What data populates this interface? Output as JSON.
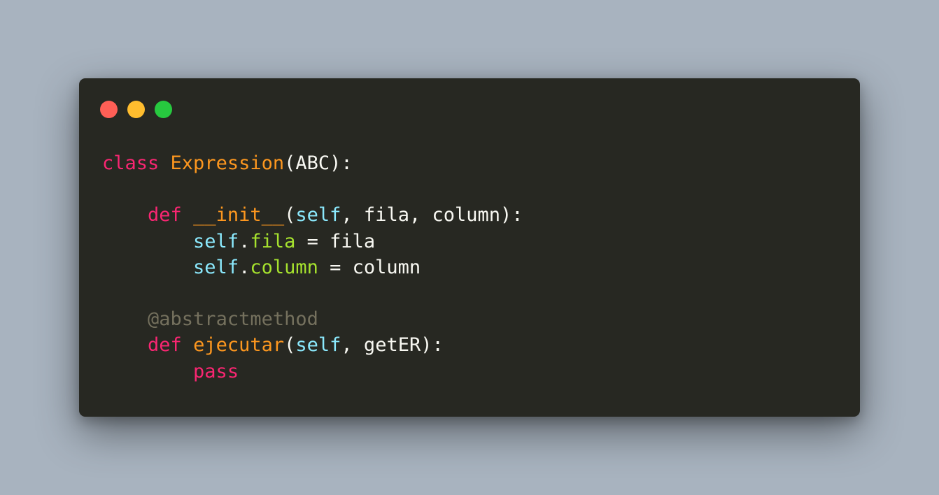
{
  "window": {
    "background": "#272822",
    "controls": [
      {
        "name": "close",
        "color": "#ff5f56"
      },
      {
        "name": "minimize",
        "color": "#ffbd2e"
      },
      {
        "name": "maximize",
        "color": "#27c93f"
      }
    ]
  },
  "page_background": "#a8b3bf",
  "colors": {
    "keyword": "#f92672",
    "function": "#fd971f",
    "self": "#8be9fd",
    "attribute": "#a6e22e",
    "plain": "#f8f8f2",
    "comment": "#75715e"
  },
  "code": {
    "language": "python",
    "lines": [
      [
        {
          "text": "class",
          "kind": "keyword"
        },
        {
          "text": " ",
          "kind": "plain"
        },
        {
          "text": "Expression",
          "kind": "function"
        },
        {
          "text": "(ABC):",
          "kind": "plain"
        }
      ],
      [],
      [
        {
          "text": "    ",
          "kind": "plain"
        },
        {
          "text": "def",
          "kind": "keyword"
        },
        {
          "text": " ",
          "kind": "plain"
        },
        {
          "text": "__init__",
          "kind": "function"
        },
        {
          "text": "(",
          "kind": "plain"
        },
        {
          "text": "self",
          "kind": "self"
        },
        {
          "text": ", fila, column):",
          "kind": "plain"
        }
      ],
      [
        {
          "text": "        ",
          "kind": "plain"
        },
        {
          "text": "self",
          "kind": "self"
        },
        {
          "text": ".",
          "kind": "plain"
        },
        {
          "text": "fila",
          "kind": "attribute"
        },
        {
          "text": " = fila",
          "kind": "plain"
        }
      ],
      [
        {
          "text": "        ",
          "kind": "plain"
        },
        {
          "text": "self",
          "kind": "self"
        },
        {
          "text": ".",
          "kind": "plain"
        },
        {
          "text": "column",
          "kind": "attribute"
        },
        {
          "text": " = column",
          "kind": "plain"
        }
      ],
      [],
      [
        {
          "text": "    ",
          "kind": "plain"
        },
        {
          "text": "@abstractmethod",
          "kind": "comment"
        }
      ],
      [
        {
          "text": "    ",
          "kind": "plain"
        },
        {
          "text": "def",
          "kind": "keyword"
        },
        {
          "text": " ",
          "kind": "plain"
        },
        {
          "text": "ejecutar",
          "kind": "function"
        },
        {
          "text": "(",
          "kind": "plain"
        },
        {
          "text": "self",
          "kind": "self"
        },
        {
          "text": ", getER):",
          "kind": "plain"
        }
      ],
      [
        {
          "text": "        ",
          "kind": "plain"
        },
        {
          "text": "pass",
          "kind": "keyword"
        }
      ]
    ]
  }
}
